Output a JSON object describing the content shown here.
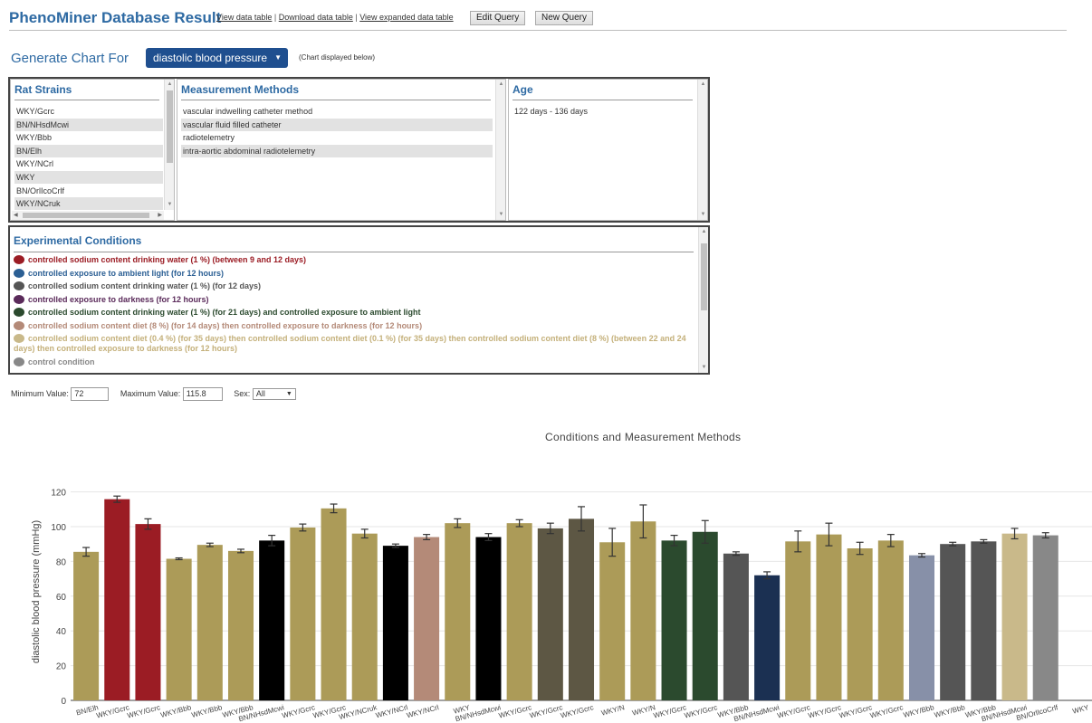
{
  "header": {
    "title": "PhenoMiner Database Result",
    "link_view_table": "View data table",
    "link_download": "Download data table",
    "link_expanded": "View expanded data table",
    "sep": "|",
    "edit_query": "Edit Query",
    "new_query": "New Query"
  },
  "generate": {
    "label": "Generate Chart For",
    "selected": "diastolic blood pressure",
    "note": "(Chart displayed below)"
  },
  "strains": {
    "title": "Rat Strains",
    "items": [
      "WKY/Gcrc",
      "BN/NHsdMcwi",
      "WKY/Bbb",
      "BN/Elh",
      "WKY/NCrl",
      "WKY",
      "BN/OrlIcoCrlf",
      "WKY/NCruk"
    ]
  },
  "methods": {
    "title": "Measurement Methods",
    "items": [
      "vascular indwelling catheter method",
      "vascular fluid filled catheter",
      "radiotelemetry",
      "intra-aortic abdominal radiotelemetry"
    ]
  },
  "age": {
    "title": "Age",
    "items": [
      "122 days - 136 days"
    ]
  },
  "conditions": {
    "title": "Experimental Conditions",
    "items": [
      {
        "text": "controlled sodium content drinking water (1 %) (between 9 and 12 days)",
        "color": "#9b1c24"
      },
      {
        "text": "controlled exposure to ambient light (for 12 hours)",
        "color": "#2b5f94"
      },
      {
        "text": "controlled sodium content drinking water (1 %) (for 12 days)",
        "color": "#555555"
      },
      {
        "text": "controlled exposure to darkness (for 12 hours)",
        "color": "#5a2a5a"
      },
      {
        "text": "controlled sodium content drinking water (1 %) (for 21 days) and controlled exposure to ambient light",
        "color": "#2b4a2e"
      },
      {
        "text": "controlled sodium content diet (8 %) (for 14 days) then controlled exposure to darkness (for 12 hours)",
        "color": "#b48a78"
      },
      {
        "text": "controlled sodium content diet (0.4 %) (for 35 days) then controlled sodium content diet (0.1 %) (for 35 days) then controlled sodium content diet (8 %) (between 22 and 24 days) then controlled exposure to darkness (for 12 hours)",
        "color": "#c9b98a"
      },
      {
        "text": "control condition",
        "color": "#888888"
      }
    ]
  },
  "filters": {
    "min_label": "Minimum Value:",
    "min_value": "72",
    "max_label": "Maximum Value:",
    "max_value": "115.8",
    "sex_label": "Sex:",
    "sex_value": "All"
  },
  "chart_data": {
    "type": "bar",
    "title": "Conditions and Measurement Methods",
    "ylabel": "diastolic blood pressure (mmHg)",
    "xlabel": "",
    "ylim": [
      0,
      125
    ],
    "yticks": [
      0,
      20,
      40,
      60,
      80,
      100,
      120
    ],
    "grid": true,
    "categories": [
      "BN/Elh",
      "WKY/Gcrc",
      "WKY/Gcrc",
      "WKY/Bbb",
      "WKY/Bbb",
      "WKY/Bbb",
      "BN/NHsdMcwi",
      "WKY/Gcrc",
      "WKY/Gcrc",
      "WKY/NCruk",
      "WKY/NCrl",
      "WKY/NCrl",
      "WKY",
      "BN/NHsdMcwi",
      "WKY/Gcrc",
      "WKY/Gcrc",
      "WKY/Gcrc",
      "WKY/N",
      "WKY/N",
      "WKY/Gcrc",
      "WKY/Gcrc",
      "WKY/Bbb",
      "BN/NHsdMcwi",
      "WKY/Gcrc",
      "WKY/Gcrc",
      "WKY/Gcrc",
      "WKY/Gcrc",
      "WKY/Bbb",
      "WKY/Bbb",
      "WKY/Bbb",
      "BN/NHsdMcwi",
      "BN/OrlIcoCrlf",
      "WKY"
    ],
    "values": [
      85.5,
      115.8,
      101.5,
      81.5,
      89.5,
      86,
      92,
      99.5,
      110.5,
      96,
      89,
      94,
      102,
      94,
      102,
      99,
      104.5,
      91,
      103,
      92,
      97,
      84.5,
      72,
      91.5,
      95.5,
      87.5,
      92,
      83.5,
      90,
      91.5,
      96,
      95
    ],
    "errors": [
      2.5,
      1.8,
      3,
      0.5,
      1,
      1,
      3,
      2,
      2.5,
      2.5,
      1,
      1.5,
      2.5,
      2,
      2,
      3,
      7,
      8,
      9.5,
      3,
      6.5,
      1,
      2,
      6,
      6.5,
      3.5,
      3.5,
      1,
      1,
      1,
      3,
      1.5
    ],
    "colors": [
      "#ac9b58",
      "#9b1c24",
      "#9b1c24",
      "#ac9b58",
      "#ac9b58",
      "#ac9b58",
      "#000000",
      "#ac9b58",
      "#ac9b58",
      "#ac9b58",
      "#000000",
      "#b48a78",
      "#ac9b58",
      "#000000",
      "#ac9b58",
      "#5d5744",
      "#5d5744",
      "#ac9b58",
      "#ac9b58",
      "#2b4a2e",
      "#2b4a2e",
      "#555555",
      "#1b3052",
      "#ac9b58",
      "#ac9b58",
      "#ac9b58",
      "#ac9b58",
      "#8790a8",
      "#555555",
      "#555555",
      "#c9b98a",
      "#888888"
    ]
  }
}
